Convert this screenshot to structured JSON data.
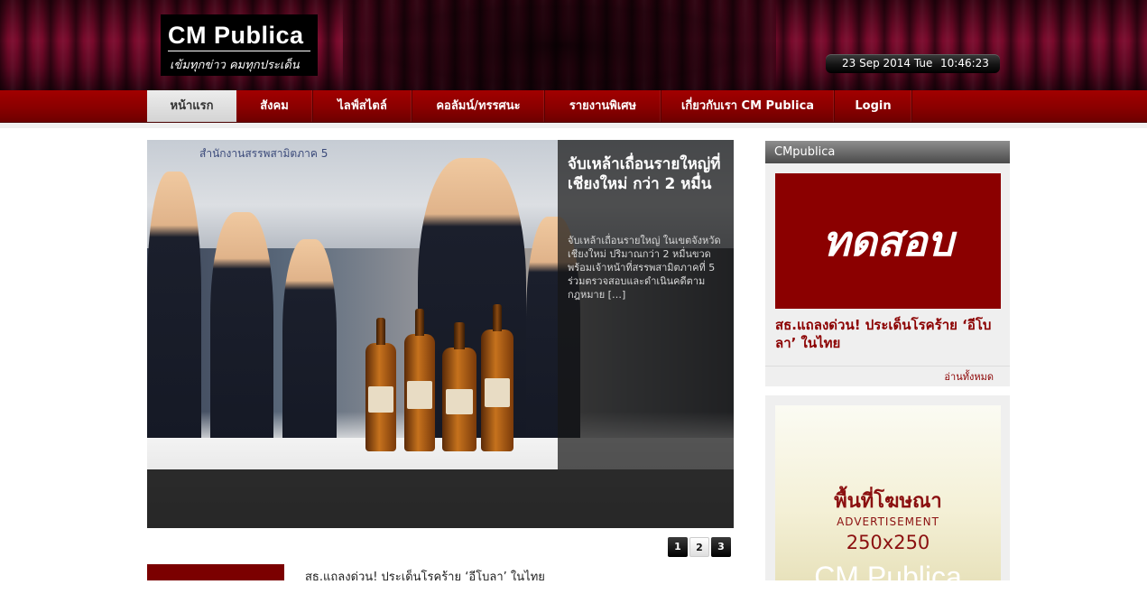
{
  "header": {
    "logo_title": "CM Publica",
    "logo_tagline": "เข้มทุกข่าว คมทุกประเด็น",
    "clock_date": "23 Sep 2014 Tue",
    "clock_time": "10:46:23"
  },
  "nav": {
    "items": [
      {
        "label": "หน้าแรก",
        "active": true
      },
      {
        "label": "สังคม"
      },
      {
        "label": "ไลฟ์สไตล์"
      },
      {
        "label": "คอลัมน์/ทรรศนะ"
      },
      {
        "label": "รายงานพิเศษ"
      },
      {
        "label": "เกี่ยวกับเรา CM Publica"
      },
      {
        "label": "Login"
      }
    ]
  },
  "slider": {
    "photo_banner": "สำนักงานสรรพสามิตภาค 5",
    "caption_title": "จับเหล้าเถื่อนรายใหญ่ที่เชียงใหม่ กว่า 2 หมื่น",
    "caption_text": "จับเหล้าเถื่อนรายใหญ่ ในเขตจังหวัดเชียงใหม่ ปริมาณกว่า 2 หมื่นขวด พร้อมเจ้าหน้าที่สรรพสามิตภาคที่ 5 ร่วมตรวจสอบและดำเนินคดีตามกฎหมาย […]",
    "pages": [
      "1",
      "2",
      "3"
    ]
  },
  "news": {
    "first_title": "สธ.แถลงด่วน! ประเด็นโรคร้าย ‘อีโบลา’ ในไทย"
  },
  "sidebar": {
    "header": "CMpublica",
    "image_text": "ทดสอบ",
    "headline": "สธ.แถลงด่วน! ประเด็นโรคร้าย ‘อีโบลา’ ในไทย",
    "read_all": "อ่านทั้งหมด"
  },
  "ad": {
    "line1": "พื้นที่โฆษณา",
    "line2": "ADVERTISEMENT",
    "line3": "250x250",
    "line4": "CM Publica"
  },
  "colors": {
    "brand_red": "#8b0000",
    "nav_red": "#a20000"
  }
}
